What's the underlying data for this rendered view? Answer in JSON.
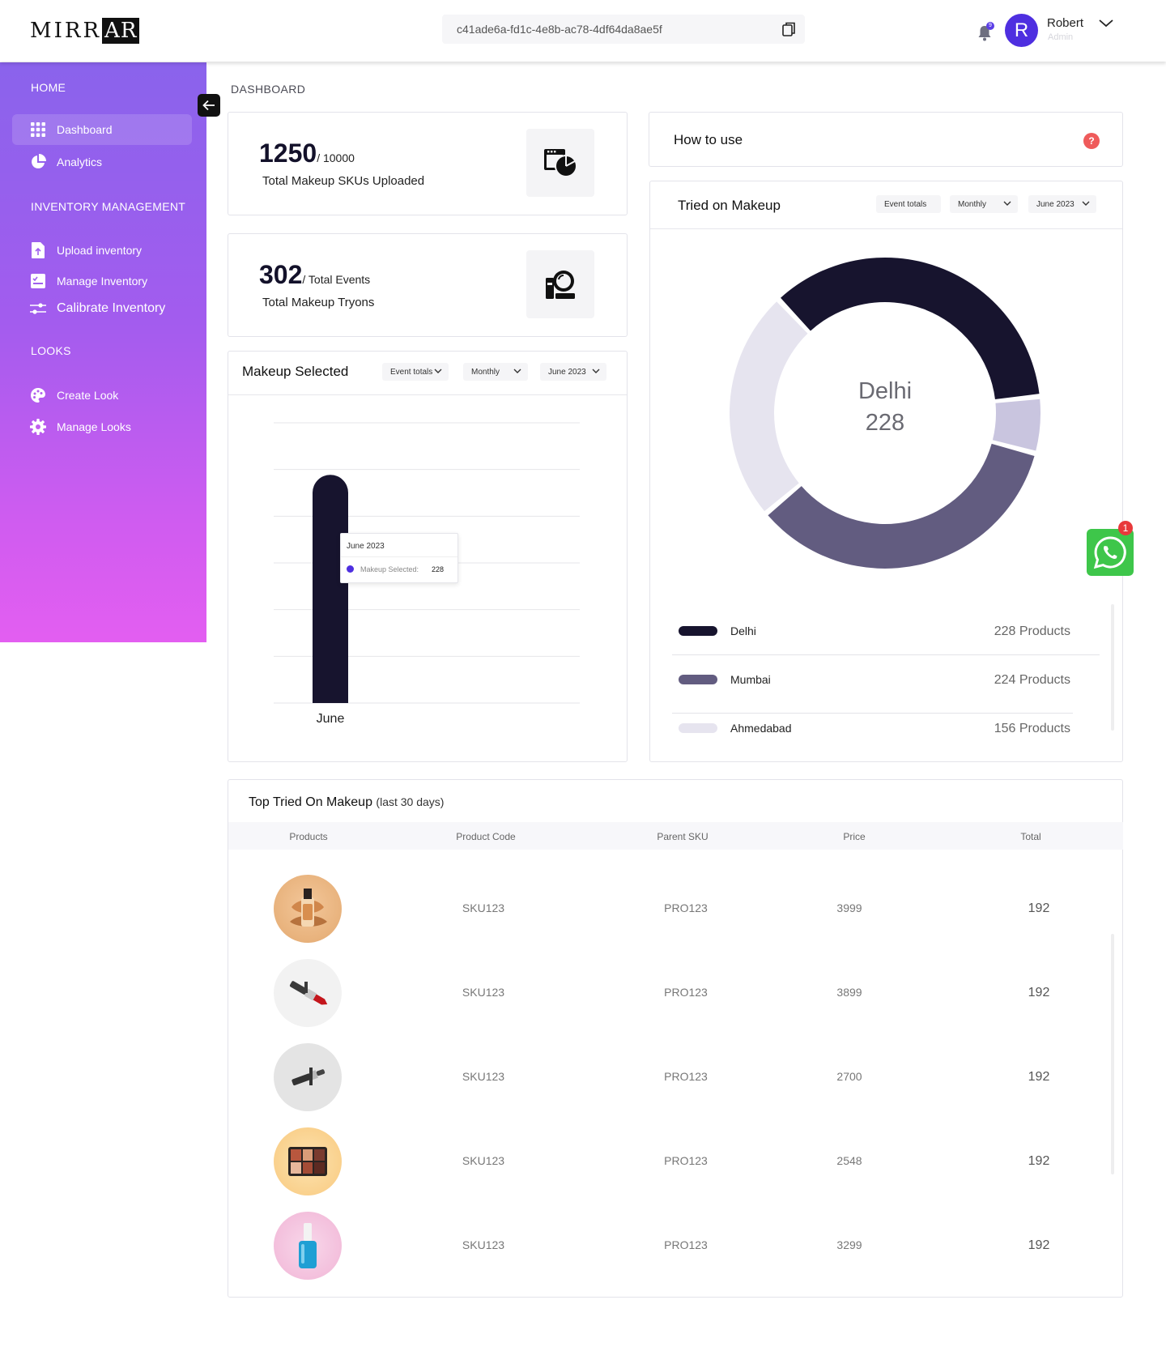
{
  "header": {
    "logo_text": "MIRR",
    "logo_text_box": "AR",
    "session_id": "c41ade6a-fd1c-4e8b-ac78-4df64da8ae5f",
    "notification_count": "9",
    "user_initial": "R",
    "user_name": "Robert",
    "user_role": "Admin"
  },
  "sidebar": {
    "section_home": "HOME",
    "section_inventory": "INVENTORY MANAGEMENT",
    "section_looks": "LOOKS",
    "items": [
      {
        "label": "Dashboard",
        "icon": "grid-icon",
        "active": true
      },
      {
        "label": "Analytics",
        "icon": "pie-chart-icon"
      },
      {
        "label": "Upload inventory",
        "icon": "upload-file-icon"
      },
      {
        "label": "Manage Inventory",
        "icon": "checklist-icon"
      },
      {
        "label": "Calibrate Inventory",
        "icon": "sliders-icon"
      },
      {
        "label": "Create Look",
        "icon": "palette-icon"
      },
      {
        "label": "Manage Looks",
        "icon": "gear-icon"
      }
    ]
  },
  "breadcrumb": "DASHBOARD",
  "stats": {
    "skus": {
      "value": "1250",
      "suffix": "/ 10000",
      "label": "Total Makeup SKUs Uploaded"
    },
    "events": {
      "value": "302",
      "suffix": "/ Total Events",
      "label": "Total Makeup Tryons"
    }
  },
  "how_to_use": {
    "title": "How to use",
    "help": "?"
  },
  "makeup_selected": {
    "title": "Makeup Selected",
    "filters": [
      "Event totals",
      "Monthly",
      "June 2023"
    ],
    "tooltip_title": "June 2023",
    "tooltip_series": "Makeup Selected:",
    "tooltip_value": "228"
  },
  "tried_on": {
    "title": "Tried on Makeup",
    "filters": [
      "Event totals",
      "Monthly",
      "June 2023"
    ],
    "center_label": "Delhi",
    "center_value": "228",
    "legend": [
      {
        "name": "Delhi",
        "value": "228 Products",
        "color": "#17142e"
      },
      {
        "name": "Mumbai",
        "value": "224 Products",
        "color": "#625c80"
      },
      {
        "name": "Ahmedabad",
        "value": "156 Products",
        "color": "#e6e4ef"
      }
    ]
  },
  "chart_data": [
    {
      "type": "bar",
      "title": "Makeup Selected",
      "categories": [
        "June"
      ],
      "series": [
        {
          "name": "Makeup Selected",
          "values": [
            228
          ]
        }
      ],
      "ylim": [
        0,
        280
      ],
      "grid": true,
      "color": "#17142e"
    },
    {
      "type": "pie",
      "title": "Tried on Makeup",
      "labels": [
        "Delhi",
        "Light segment",
        "Mumbai",
        "Ahmedabad"
      ],
      "values": [
        228,
        38,
        224,
        156
      ],
      "colors": [
        "#17142e",
        "#c9c5df",
        "#625c80",
        "#e6e4ef"
      ]
    }
  ],
  "whatsapp": {
    "badge": "1",
    "icon": "whatsapp-icon"
  },
  "top_tried": {
    "title": "Top Tried On Makeup",
    "subtitle": "(last 30 days)",
    "columns": [
      "Products",
      "Product Code",
      "Parent SKU",
      "Price",
      "Total"
    ],
    "rows": [
      {
        "product": "foundation-product",
        "code": "SKU123",
        "parent": "PRO123",
        "price": "3999",
        "total": "192"
      },
      {
        "product": "lipstick-product",
        "code": "SKU123",
        "parent": "PRO123",
        "price": "3899",
        "total": "192"
      },
      {
        "product": "lip-brush-product",
        "code": "SKU123",
        "parent": "PRO123",
        "price": "2700",
        "total": "192"
      },
      {
        "product": "eyeshadow-palette-product",
        "code": "SKU123",
        "parent": "PRO123",
        "price": "2548",
        "total": "192"
      },
      {
        "product": "nail-polish-product",
        "code": "SKU123",
        "parent": "PRO123",
        "price": "3299",
        "total": "192"
      }
    ]
  }
}
